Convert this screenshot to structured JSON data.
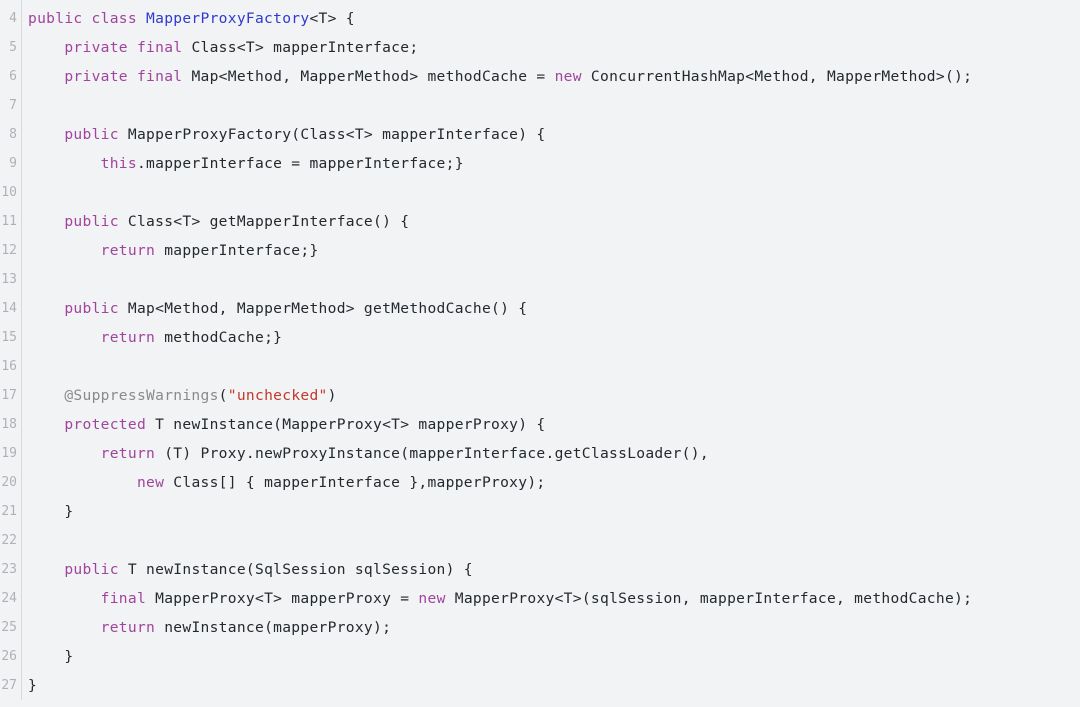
{
  "editor": {
    "language": "java",
    "file_kind": "source-code-view",
    "background_color": "#f2f3f5",
    "gutter_divider_color": "#d7d9dd",
    "line_number_color": "#aeb2b8",
    "first_line_number": 4,
    "last_line_number": 27,
    "colors": {
      "keyword": "#a0449e",
      "type_declaration": "#2f3ad0",
      "string": "#c0392b",
      "annotation": "#8a8a8a",
      "plain": "#24292e"
    }
  },
  "lines": [
    {
      "number": "4",
      "tokens": [
        {
          "text": "public class ",
          "kind": "keyword"
        },
        {
          "text": "MapperProxyFactory",
          "kind": "type_declaration"
        },
        {
          "text": "<T> {",
          "kind": "plain"
        }
      ]
    },
    {
      "number": "5",
      "tokens": [
        {
          "text": "    ",
          "kind": "plain"
        },
        {
          "text": "private final ",
          "kind": "keyword"
        },
        {
          "text": "Class<T> mapperInterface;",
          "kind": "plain"
        }
      ]
    },
    {
      "number": "6",
      "tokens": [
        {
          "text": "    ",
          "kind": "plain"
        },
        {
          "text": "private final ",
          "kind": "keyword"
        },
        {
          "text": "Map<Method, MapperMethod> methodCache = ",
          "kind": "plain"
        },
        {
          "text": "new ",
          "kind": "keyword"
        },
        {
          "text": "ConcurrentHashMap<Method, MapperMethod>();",
          "kind": "plain"
        }
      ]
    },
    {
      "number": "7",
      "tokens": []
    },
    {
      "number": "8",
      "tokens": [
        {
          "text": "    ",
          "kind": "plain"
        },
        {
          "text": "public ",
          "kind": "keyword"
        },
        {
          "text": "MapperProxyFactory(Class<T> mapperInterface) {",
          "kind": "plain"
        }
      ]
    },
    {
      "number": "9",
      "tokens": [
        {
          "text": "        ",
          "kind": "plain"
        },
        {
          "text": "this",
          "kind": "keyword"
        },
        {
          "text": ".mapperInterface = mapperInterface;}",
          "kind": "plain"
        }
      ]
    },
    {
      "number": "10",
      "tokens": []
    },
    {
      "number": "11",
      "tokens": [
        {
          "text": "    ",
          "kind": "plain"
        },
        {
          "text": "public ",
          "kind": "keyword"
        },
        {
          "text": "Class<T> getMapperInterface() {",
          "kind": "plain"
        }
      ]
    },
    {
      "number": "12",
      "tokens": [
        {
          "text": "        ",
          "kind": "plain"
        },
        {
          "text": "return ",
          "kind": "keyword"
        },
        {
          "text": "mapperInterface;}",
          "kind": "plain"
        }
      ]
    },
    {
      "number": "13",
      "tokens": []
    },
    {
      "number": "14",
      "tokens": [
        {
          "text": "    ",
          "kind": "plain"
        },
        {
          "text": "public ",
          "kind": "keyword"
        },
        {
          "text": "Map<Method, MapperMethod> getMethodCache() {",
          "kind": "plain"
        }
      ]
    },
    {
      "number": "15",
      "tokens": [
        {
          "text": "        ",
          "kind": "plain"
        },
        {
          "text": "return ",
          "kind": "keyword"
        },
        {
          "text": "methodCache;}",
          "kind": "plain"
        }
      ]
    },
    {
      "number": "16",
      "tokens": []
    },
    {
      "number": "17",
      "tokens": [
        {
          "text": "    ",
          "kind": "plain"
        },
        {
          "text": "@SuppressWarnings",
          "kind": "annotation"
        },
        {
          "text": "(",
          "kind": "plain"
        },
        {
          "text": "\"unchecked\"",
          "kind": "string"
        },
        {
          "text": ")",
          "kind": "plain"
        }
      ]
    },
    {
      "number": "18",
      "tokens": [
        {
          "text": "    ",
          "kind": "plain"
        },
        {
          "text": "protected ",
          "kind": "keyword"
        },
        {
          "text": "T newInstance(MapperProxy<T> mapperProxy) {",
          "kind": "plain"
        }
      ]
    },
    {
      "number": "19",
      "tokens": [
        {
          "text": "        ",
          "kind": "plain"
        },
        {
          "text": "return ",
          "kind": "keyword"
        },
        {
          "text": "(T) Proxy.newProxyInstance(mapperInterface.getClassLoader(),",
          "kind": "plain"
        }
      ]
    },
    {
      "number": "20",
      "tokens": [
        {
          "text": "            ",
          "kind": "plain"
        },
        {
          "text": "new ",
          "kind": "keyword"
        },
        {
          "text": "Class[] { mapperInterface },mapperProxy);",
          "kind": "plain"
        }
      ]
    },
    {
      "number": "21",
      "tokens": [
        {
          "text": "    }",
          "kind": "plain"
        }
      ]
    },
    {
      "number": "22",
      "tokens": []
    },
    {
      "number": "23",
      "tokens": [
        {
          "text": "    ",
          "kind": "plain"
        },
        {
          "text": "public ",
          "kind": "keyword"
        },
        {
          "text": "T newInstance(SqlSession sqlSession) {",
          "kind": "plain"
        }
      ]
    },
    {
      "number": "24",
      "tokens": [
        {
          "text": "        ",
          "kind": "plain"
        },
        {
          "text": "final ",
          "kind": "keyword"
        },
        {
          "text": "MapperProxy<T> mapperProxy = ",
          "kind": "plain"
        },
        {
          "text": "new ",
          "kind": "keyword"
        },
        {
          "text": "MapperProxy<T>(sqlSession, mapperInterface, methodCache);",
          "kind": "plain"
        }
      ]
    },
    {
      "number": "25",
      "tokens": [
        {
          "text": "        ",
          "kind": "plain"
        },
        {
          "text": "return ",
          "kind": "keyword"
        },
        {
          "text": "newInstance(mapperProxy);",
          "kind": "plain"
        }
      ]
    },
    {
      "number": "26",
      "tokens": [
        {
          "text": "    }",
          "kind": "plain"
        }
      ]
    },
    {
      "number": "27",
      "tokens": [
        {
          "text": "}",
          "kind": "plain"
        }
      ]
    }
  ]
}
